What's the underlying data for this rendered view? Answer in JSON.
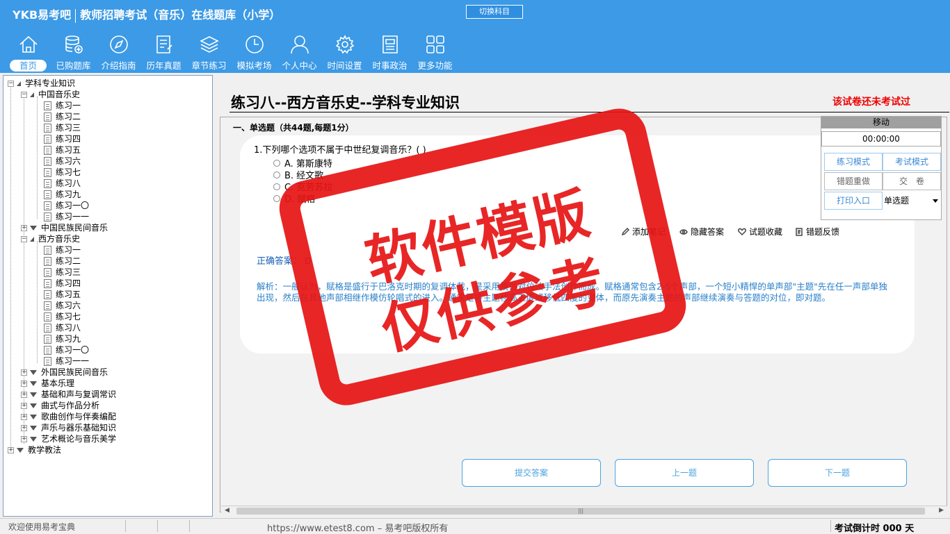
{
  "header": {
    "brand": "YKB易考吧",
    "title": "教师招聘考试（音乐）在线题库（小学）",
    "switch_subject": "切换科目",
    "bg_color": "#3c9ae6"
  },
  "nav": [
    {
      "label": "首页",
      "icon": "home-icon",
      "active": true
    },
    {
      "label": "已购题库",
      "icon": "database-icon"
    },
    {
      "label": "介绍指南",
      "icon": "compass-icon"
    },
    {
      "label": "历年真题",
      "icon": "document-list-icon"
    },
    {
      "label": "章节练习",
      "icon": "layers-icon"
    },
    {
      "label": "模拟考场",
      "icon": "clock-icon"
    },
    {
      "label": "个人中心",
      "icon": "user-icon"
    },
    {
      "label": "时间设置",
      "icon": "gear-icon"
    },
    {
      "label": "时事政治",
      "icon": "newspaper-icon"
    },
    {
      "label": "更多功能",
      "icon": "grid-icon"
    }
  ],
  "tree": {
    "root": "学科专业知识",
    "chinese_music_history": "中国音乐史",
    "chinese_items": [
      "练习一",
      "练习二",
      "练习三",
      "练习四",
      "练习五",
      "练习六",
      "练习七",
      "练习八",
      "练习九",
      "练习一〇",
      "练习一一"
    ],
    "chinese_folk": "中国民族民间音乐",
    "western_music_history": "西方音乐史",
    "western_items": [
      "练习一",
      "练习二",
      "练习三",
      "练习四",
      "练习五",
      "练习六",
      "练习七",
      "练习八",
      "练习九",
      "练习一〇",
      "练习一一"
    ],
    "other_groups": [
      "外国民族民间音乐",
      "基本乐理",
      "基础和声与复调常识",
      "曲式与作品分析",
      "歌曲创作与伴奏编配",
      "声乐与器乐基础知识",
      "艺术概论与音乐美学"
    ],
    "teaching": "教学教法"
  },
  "main": {
    "title": "练习八--西方音乐史--学科专业知识",
    "status": "该试卷还未考试过",
    "section": "一、单选题（共44题,每题1分）",
    "question": "1.下列哪个选项不属于中世纪复调音乐？( )",
    "options": [
      "A. 第斯康特",
      "B. 经文歌",
      "C. 克劳苏拉",
      "D. 赋格"
    ],
    "tools": [
      "添加笔记",
      "隐藏答案",
      "试题收藏",
      "错题反馈"
    ],
    "answer_label": "正确答案：",
    "answer_value": "D",
    "explanation": "解析：一般认为，赋格是盛行于巴洛克时期的复调体裁，是采用模仿对位法手法创作而成。赋格通常包含2-5个声部，一个短小精悍的单声部\"主题\"先在任一声部单独出现，然后在其他声部相继作模仿轮唱式的进入。通常是将主题移高五度或移低四度的变体，而原先演奏主题的声部继续演奏与答题的对位，即对题。",
    "buttons": {
      "submit": "提交答案",
      "prev": "上一题",
      "next": "下一题"
    }
  },
  "float_panel": {
    "move": "移动",
    "timer": "00:00:00",
    "practice_mode": "练习模式",
    "exam_mode": "考试模式",
    "redo_wrong": "错题重做",
    "hand_in": "交　卷",
    "print": "打印入口",
    "type_select": "单选题"
  },
  "statusbar": {
    "welcome": "欢迎使用易考宝典",
    "copyright": "https://www.etest8.com – 易考吧版权所有",
    "countdown": "考试倒计时 000 天"
  },
  "watermark": {
    "line1": "软件模版",
    "line2": "仅供参考",
    "color": "#e61414"
  }
}
